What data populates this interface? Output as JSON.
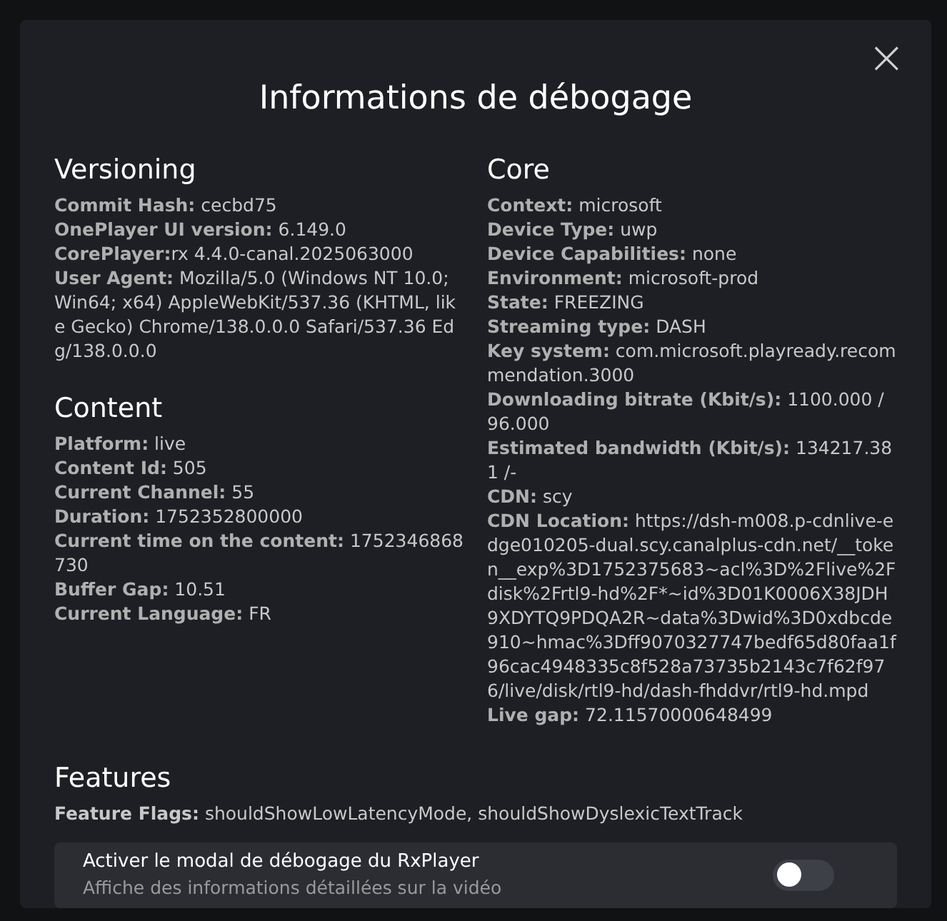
{
  "dialog": {
    "title": "Informations de débogage",
    "close_icon": "×"
  },
  "sections_left": [
    {
      "title": "Versioning",
      "entries": [
        "**Commit Hash:** cecbd75",
        "**OnePlayer UI version:** 6.149.0",
        "**CorePlayer:**rx 4.4.0-canal.2025063000",
        "**User Agent:** Mozilla/5.0 (Windows NT 10.0; Win64; x64) AppleWebKit/537.36 (KHTML, like Gecko) Chrome/138.0.0.0 Safari/537.36 Edg/138.0.0.0"
      ]
    },
    {
      "title": "Content",
      "entries": [
        "**Platform:** live",
        "**Content Id:** 505",
        "**Current Channel:** 55",
        "**Duration:** 1752352800000",
        "**Current time on the content:** 1752346868730",
        "**Buffer Gap:** 10.51",
        "**Current Language:** FR"
      ]
    }
  ],
  "sections_right": [
    {
      "title": "Core",
      "entries": [
        "**Context:** microsoft",
        "**Device Type:** uwp",
        "**Device Capabilities:** none",
        "**Environment:** microsoft-prod",
        "**State:** FREEZING",
        "**Streaming type:** DASH",
        "**Key system:** com.microsoft.playready.recommendation.3000",
        "**Downloading bitrate (Kbit/s):** 1100.000 / 96.000",
        "**Estimated bandwidth (Kbit/s):** 134217.381 /-",
        "**CDN:** scy",
        "**CDN Location:** https://dsh-m008.p-cdnlive-edge010205-dual.scy.canalplus-cdn.net/__token__exp%3D1752375683~acl%3D%2Flive%2Fdisk%2Frtl9-hd%2F*~id%3D01K0006X38JDH9XDYTQ9PDQA2R~data%3Dwid%3D0xdbcde910~hmac%3Dff9070327747bedf65d80faa1f96cac4948335c8f528a73735b2143c7f62f976/live/disk/rtl9-hd/dash-fhddvr/rtl9-hd.mpd",
        "**Live gap:** 72.11570000648499"
      ]
    }
  ],
  "features": {
    "title": "Features",
    "flags": "**Feature Flags:** shouldShowLowLatencyMode, shouldShowDyslexicTextTrack"
  },
  "setting": {
    "label": "Activer le modal de débogage du RxPlayer",
    "description": "Affiche des informations détaillées sur la vidéo",
    "on": false
  }
}
